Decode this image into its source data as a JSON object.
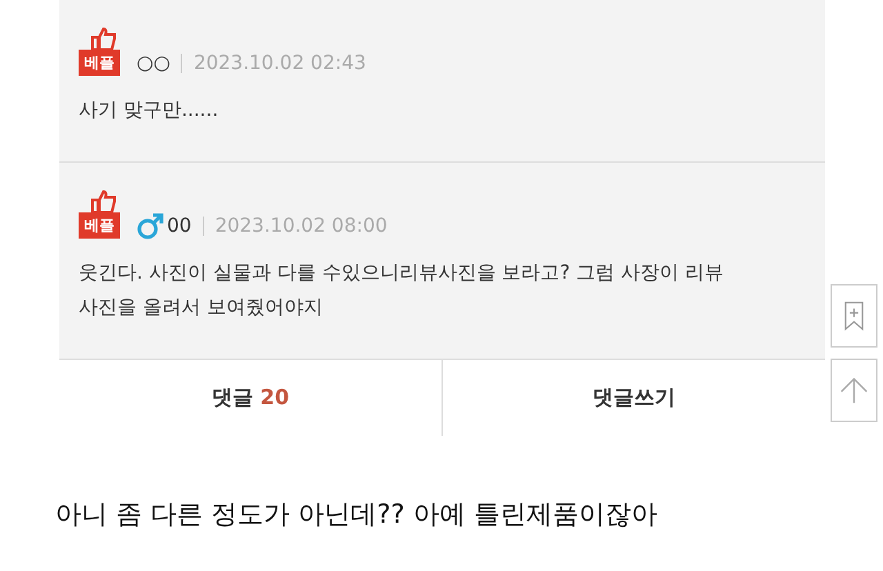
{
  "comments": [
    {
      "badge": "베플",
      "author": "○○",
      "date": "2023.10.02 02:43",
      "text": "사기 맞구만......"
    },
    {
      "badge": "베플",
      "male": true,
      "author": "00",
      "date": "2023.10.02 08:00",
      "text": "웃긴다. 사진이 실물과 다를 수있으니리뷰사진을 보라고? 그럼 사장이 리뷰사진을 올려서 보여줬어야지"
    }
  ],
  "tabs": [
    {
      "label": "댓글",
      "count": "20"
    },
    {
      "label": "댓글쓰기"
    }
  ],
  "caption": "아니 좀 다른 정도가 아닌데?? 아예 틀린제품이잖아"
}
